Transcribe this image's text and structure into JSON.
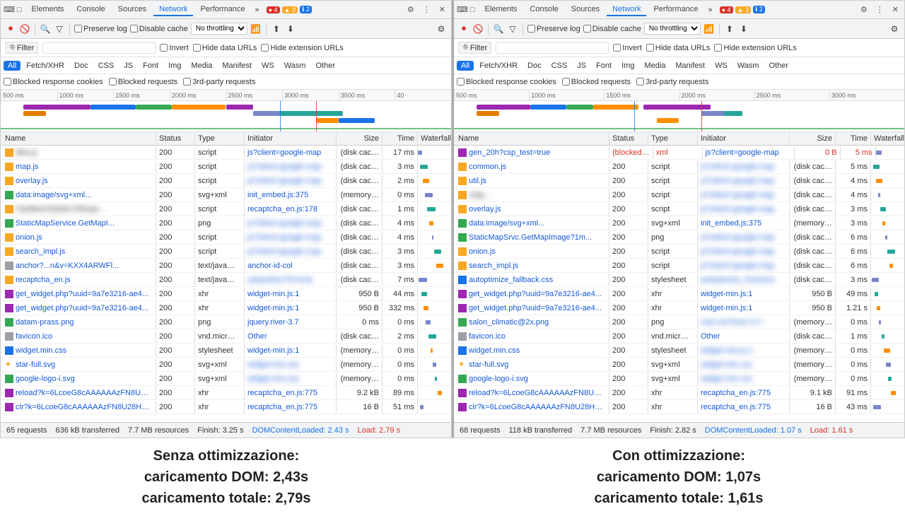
{
  "panels": [
    {
      "id": "left",
      "tabs": [
        "Elements",
        "Console",
        "Sources",
        "Network",
        "Performance"
      ],
      "active_tab": "Network",
      "badges": {
        "errors": "4",
        "warnings": "3",
        "info": "2"
      },
      "toolbar": {
        "preserve_log": "Preserve log",
        "disable_cache": "Disable cache",
        "throttling": "No throttling"
      },
      "filter": {
        "label": "Filter",
        "invert": "Invert",
        "hide_data_urls": "Hide data URLs",
        "hide_ext_urls": "Hide extension URLs"
      },
      "type_filters": [
        "All",
        "Fetch/XHR",
        "Doc",
        "CSS",
        "JS",
        "Font",
        "Img",
        "Media",
        "Manifest",
        "WS",
        "Wasm",
        "Other"
      ],
      "active_type": "All",
      "blocked_checkboxes": [
        "Blocked response cookies",
        "Blocked requests",
        "3rd-party requests"
      ],
      "ruler_marks": [
        "500 ms",
        "1000 ms",
        "1500 ms",
        "2000 ms",
        "2500 ms",
        "3000 ms",
        "3500 ms",
        "40"
      ],
      "columns": [
        "Name",
        "Status",
        "Type",
        "Initiator",
        "Size",
        "Time"
      ],
      "rows": [
        {
          "icon": "js",
          "name": "tiles.js",
          "status": "200",
          "type": "script",
          "initiator": "js?client=google-map",
          "size": "(disk cac…",
          "time": "17 ms",
          "blurred_name": true
        },
        {
          "icon": "js",
          "name": "map.js",
          "status": "200",
          "type": "script",
          "initiator": "js?client=google-map",
          "size": "(disk cac…",
          "time": "3 ms",
          "blurred_initiator": true
        },
        {
          "icon": "js",
          "name": "overlay.js",
          "status": "200",
          "type": "script",
          "initiator": "js?client=google-map",
          "size": "(disk cac…",
          "time": "2 ms",
          "blurred_initiator": true
        },
        {
          "icon": "img",
          "name": "data:image/svg+xml...",
          "status": "200",
          "type": "svg+xml",
          "initiator": "init_embed.js:375",
          "size": "(memory…",
          "time": "0 ms"
        },
        {
          "icon": "js",
          "name": "FqrMbwVIQ0dcI74Nxqo...",
          "status": "200",
          "type": "script",
          "initiator": "recaptcha_en.js:178",
          "size": "(disk cac…",
          "time": "1 ms",
          "blurred_name": true
        },
        {
          "icon": "img",
          "name": "StaticMapService.GetMapI...",
          "status": "200",
          "type": "png",
          "initiator": "js?client=google-map",
          "size": "(disk cac…",
          "time": "4 ms",
          "blurred_initiator": true
        },
        {
          "icon": "js",
          "name": "onion.js",
          "status": "200",
          "type": "script",
          "initiator": "js?client=google-map",
          "size": "(disk cac…",
          "time": "4 ms",
          "blurred_initiator": true
        },
        {
          "icon": "js",
          "name": "search_impl.js",
          "status": "200",
          "type": "script",
          "initiator": "js?client=google-map",
          "size": "(disk cac…",
          "time": "3 ms",
          "blurred_initiator": true
        },
        {
          "icon": "other",
          "name": "anchor?...n&v=KXX4ARWFl...",
          "status": "200",
          "type": "text/java…",
          "initiator": "anchor-id-col",
          "size": "(disk cac…",
          "time": "3 ms",
          "blurred": true
        },
        {
          "icon": "js",
          "name": "recaptcha_en.js",
          "status": "200",
          "type": "text/java…",
          "initiator": "webauthor?hl=en&",
          "size": "(disk cac…",
          "time": "7 ms",
          "blurred_initiator": true
        },
        {
          "icon": "xhr",
          "name": "get_widget.php?uuid=9a7e3216-ae4...",
          "status": "200",
          "type": "xhr",
          "initiator": "widget-min.js:1",
          "size": "950 B",
          "time": "44 ms"
        },
        {
          "icon": "xhr",
          "name": "get_widget.php?uuid=9a7e3216-ae4...",
          "status": "200",
          "type": "xhr",
          "initiator": "widget-min.js:1",
          "size": "950 B",
          "time": "332 ms"
        },
        {
          "icon": "img",
          "name": "datam-prass.png",
          "status": "200",
          "type": "png",
          "initiator": "jquery.river-3.7",
          "size": "0 ms",
          "time": "0 ms"
        },
        {
          "icon": "other",
          "name": "favicon.ico",
          "status": "200",
          "type": "vnd.micr…",
          "initiator": "Other",
          "size": "(disk cac…",
          "time": "2 ms"
        },
        {
          "icon": "css",
          "name": "widget.min.css",
          "status": "200",
          "type": "stylesheet",
          "initiator": "widget-min.js:1",
          "size": "(memory…",
          "time": "0 ms"
        },
        {
          "icon": "star",
          "name": "star-full.svg",
          "status": "200",
          "type": "svg+xml",
          "initiator": "widget-min.css",
          "size": "(memory…",
          "time": "0 ms",
          "blurred_initiator": true
        },
        {
          "icon": "img",
          "name": "google-logo-i.svg",
          "status": "200",
          "type": "svg+xml",
          "initiator": "widget-min.css",
          "size": "(memory…",
          "time": "0 ms",
          "blurred_initiator": true
        },
        {
          "icon": "xhr",
          "name": "reload?k=6LcoeG8cAAAAAAzFN8U2...",
          "status": "200",
          "type": "xhr",
          "initiator": "recaptcha_en.js:775",
          "size": "9.2 kB",
          "time": "89 ms"
        },
        {
          "icon": "xhr",
          "name": "clr?k=6LcoeG8cAAAAAAzFN8U28H7...",
          "status": "200",
          "type": "xhr",
          "initiator": "recaptcha_en.js:775",
          "size": "16 B",
          "time": "51 ms"
        }
      ],
      "status_bar": {
        "requests": "65 requests",
        "transferred": "636 kB transferred",
        "resources": "7.7 MB resources",
        "finish": "Finish: 3.25 s",
        "dom_content": "DOMContentLoaded: 2.43 s",
        "load": "Load: 2.79 s"
      },
      "caption": {
        "line1": "Senza ottimizzazione:",
        "line2": "caricamento DOM: 2,43s",
        "line3": "caricamento totale: 2,79s"
      }
    },
    {
      "id": "right",
      "tabs": [
        "Elements",
        "Console",
        "Sources",
        "Network",
        "Performance"
      ],
      "active_tab": "Network",
      "badges": {
        "errors": "4",
        "warnings": "3",
        "info": "2"
      },
      "toolbar": {
        "preserve_log": "Preserve log",
        "disable_cache": "Disable cache",
        "throttling": "No throttling"
      },
      "filter": {
        "label": "Filter",
        "invert": "Invert",
        "hide_data_urls": "Hide data URLs",
        "hide_ext_urls": "Hide extension URLs"
      },
      "type_filters": [
        "All",
        "Fetch/XHR",
        "Doc",
        "CSS",
        "JS",
        "Font",
        "Img",
        "Media",
        "Manifest",
        "WS",
        "Wasm",
        "Other"
      ],
      "active_type": "All",
      "blocked_checkboxes": [
        "Blocked response cookies",
        "Blocked requests",
        "3rd-party requests"
      ],
      "ruler_marks": [
        "500 ms",
        "1000 ms",
        "1500 ms",
        "2000 ms",
        "2500 ms",
        "3000 ms"
      ],
      "columns": [
        "Name",
        "Status",
        "Type",
        "Initiator",
        "Size",
        "Time"
      ],
      "rows": [
        {
          "icon": "xhr",
          "name": "gen_20h?csp_test=true",
          "status": "(blocked…",
          "type": "xml",
          "initiator": "js?client=google-map",
          "size": "0 B",
          "time": "5 ms",
          "error": true
        },
        {
          "icon": "js",
          "name": "common.js",
          "status": "200",
          "type": "script",
          "initiator": "js?client=google-map",
          "size": "(disk cac…",
          "time": "5 ms",
          "blurred_initiator": true
        },
        {
          "icon": "js",
          "name": "util.js",
          "status": "200",
          "type": "script",
          "initiator": "js?client=google-map",
          "size": "(disk cac…",
          "time": "4 ms",
          "blurred_initiator": true
        },
        {
          "icon": "js",
          "name": "map…",
          "status": "200",
          "type": "script",
          "initiator": "js?client=google-map",
          "size": "(disk cac…",
          "time": "4 ms",
          "blurred_name": true,
          "blurred_initiator": true
        },
        {
          "icon": "js",
          "name": "overlay.js",
          "status": "200",
          "type": "script",
          "initiator": "js?client=google-map",
          "size": "(disk cac…",
          "time": "3 ms",
          "blurred_initiator": true
        },
        {
          "icon": "img",
          "name": "data:image/svg+xml...",
          "status": "200",
          "type": "svg+xml",
          "initiator": "init_embed.js:375",
          "size": "(memory…",
          "time": "3 ms"
        },
        {
          "icon": "img",
          "name": "StaticMapSrvc.GetMapImage?1m...",
          "status": "200",
          "type": "png",
          "initiator": "js?client=google-map",
          "size": "(disk cac…",
          "time": "6 ms",
          "blurred_initiator": true
        },
        {
          "icon": "js",
          "name": "onion.js",
          "status": "200",
          "type": "script",
          "initiator": "js?client=google-map",
          "size": "(disk cac…",
          "time": "6 ms",
          "blurred_initiator": true
        },
        {
          "icon": "js",
          "name": "search_impl.js",
          "status": "200",
          "type": "script",
          "initiator": "js?client=google-map",
          "size": "(disk cac…",
          "time": "6 ms",
          "blurred_initiator": true
        },
        {
          "icon": "css",
          "name": "autoptimize_fallback.css",
          "status": "200",
          "type": "stylesheet",
          "initiator": "autoptimize_541e2ce",
          "size": "(disk cac…",
          "time": "3 ms",
          "blurred_initiator": true
        },
        {
          "icon": "xhr",
          "name": "get_widget.php?uuid=9a7e3216-ae4...",
          "status": "200",
          "type": "xhr",
          "initiator": "widget-min.js:1",
          "size": "950 B",
          "time": "49 ms"
        },
        {
          "icon": "xhr",
          "name": "get_widget.php?uuid=9a7e3216-ae4...",
          "status": "200",
          "type": "xhr",
          "initiator": "widget-min.js:1",
          "size": "950 B",
          "time": "1.21 s"
        },
        {
          "icon": "img",
          "name": "salon_climatic@2x.png",
          "status": "200",
          "type": "png",
          "initiator": "mat-css?river=3.7",
          "size": "(memory…",
          "time": "0 ms",
          "blurred_initiator": true
        },
        {
          "icon": "other",
          "name": "favicon.ico",
          "status": "200",
          "type": "vnd.micr…",
          "initiator": "Other",
          "size": "(disk cac…",
          "time": "1 ms"
        },
        {
          "icon": "css",
          "name": "widget.min.css",
          "status": "200",
          "type": "stylesheet",
          "initiator": "widget-min.js:1",
          "size": "(memory…",
          "time": "0 ms",
          "blurred_initiator": true
        },
        {
          "icon": "star",
          "name": "star-full.svg",
          "status": "200",
          "type": "svg+xml",
          "initiator": "widget-min.css",
          "size": "(memory…",
          "time": "0 ms",
          "blurred_initiator": true
        },
        {
          "icon": "img",
          "name": "google-logo-i.svg",
          "status": "200",
          "type": "svg+xml",
          "initiator": "widget-min.css",
          "size": "(memory…",
          "time": "0 ms",
          "blurred_initiator": true
        },
        {
          "icon": "xhr",
          "name": "reload?k=6LcoeG8cAAAAAAzFN8U2...",
          "status": "200",
          "type": "xhr",
          "initiator": "recaptcha_en.js:775",
          "size": "9.1 kB",
          "time": "91 ms"
        },
        {
          "icon": "xhr",
          "name": "clr?k=6LcoeG8cAAAAAAzFN8U28H7...",
          "status": "200",
          "type": "xhr",
          "initiator": "recaptcha_en.js:775",
          "size": "16 B",
          "time": "43 ms"
        }
      ],
      "status_bar": {
        "requests": "68 requests",
        "transferred": "118 kB transferred",
        "resources": "7.7 MB resources",
        "finish": "Finish: 2.82 s",
        "dom_content": "DOMContentLoaded: 1.07 s",
        "load": "Load: 1.61 s"
      },
      "caption": {
        "line1": "Con ottimizzazione:",
        "line2": "caricamento DOM: 1,07s",
        "line3": "caricamento totale: 1,61s"
      }
    }
  ],
  "icons": {
    "circle_record": "⏺",
    "stop": "⏹",
    "clear": "🚫",
    "search": "🔍",
    "filter": "▼",
    "import": "⬆",
    "export": "⬇",
    "settings": "⚙",
    "more": "⋮",
    "close": "✕",
    "wifi": "📶",
    "chevron": "›",
    "funnel": "⛗"
  }
}
